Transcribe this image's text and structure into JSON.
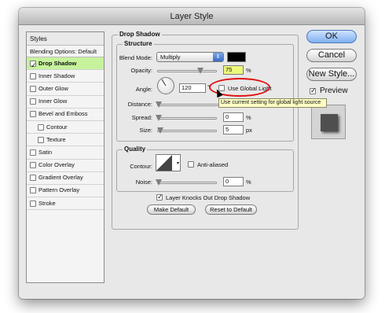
{
  "window": {
    "title": "Layer Style"
  },
  "sidebar": {
    "header": "Styles",
    "blending_options": "Blending Options: Default",
    "items": [
      {
        "label": "Drop Shadow",
        "checked": true,
        "selected": true
      },
      {
        "label": "Inner Shadow",
        "checked": false
      },
      {
        "label": "Outer Glow",
        "checked": false
      },
      {
        "label": "Inner Glow",
        "checked": false
      },
      {
        "label": "Bevel and Emboss",
        "checked": false
      },
      {
        "label": "Contour",
        "checked": false,
        "indent": true
      },
      {
        "label": "Texture",
        "checked": false,
        "indent": true
      },
      {
        "label": "Satin",
        "checked": false
      },
      {
        "label": "Color Overlay",
        "checked": false
      },
      {
        "label": "Gradient Overlay",
        "checked": false
      },
      {
        "label": "Pattern Overlay",
        "checked": false
      },
      {
        "label": "Stroke",
        "checked": false
      }
    ]
  },
  "drop_shadow": {
    "title": "Drop Shadow",
    "structure": {
      "title": "Structure",
      "blend_mode_label": "Blend Mode:",
      "blend_mode_value": "Multiply",
      "shadow_color": "#000000",
      "opacity_label": "Opacity:",
      "opacity_value": "75",
      "opacity_unit": "%",
      "angle_label": "Angle:",
      "angle_value": "120",
      "angle_unit": "°",
      "global_light_label": "Use Global Light",
      "distance_label": "Distance:",
      "distance_value": "5",
      "distance_unit": "px",
      "spread_label": "Spread:",
      "spread_value": "0",
      "spread_unit": "%",
      "size_label": "Size:",
      "size_value": "5",
      "size_unit": "px"
    },
    "quality": {
      "title": "Quality",
      "contour_label": "Contour:",
      "anti_aliased_label": "Anti-aliased",
      "noise_label": "Noise:",
      "noise_value": "0",
      "noise_unit": "%"
    },
    "knockout_label": "Layer Knocks Out Drop Shadow",
    "make_default_label": "Make Default",
    "reset_default_label": "Reset to Default"
  },
  "tooltip": {
    "text": "Use current setting for global light source"
  },
  "actions": {
    "ok_label": "OK",
    "cancel_label": "Cancel",
    "new_style_label": "New Style...",
    "preview_label": "Preview"
  }
}
